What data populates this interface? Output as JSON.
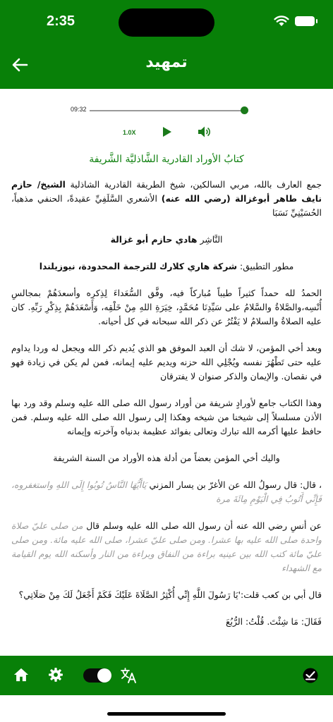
{
  "status": {
    "time": "2:35"
  },
  "header": {
    "title": "تمهيد"
  },
  "player": {
    "elapsed": "09:32",
    "speed": "1.0X",
    "progress": 0.98
  },
  "content": {
    "book_title": "كتابُ الأوراد القادرية الشَّاذليَّة الشَّريفة",
    "intro": "جمع العارف بالله، مربي السالكين، شيخ الطريقة القادرية الشاذلية ",
    "sheikh_name": "الشيخ/ حازم نايف طاهر أبوغزالة (رضي الله عنه)",
    "intro_rest": " الأشعري السَّلَفِيِّ عقيدةً، الحنفي مذهباً، الحُسَيْنِيِّ نَسَبَا",
    "publisher_label": "النَّاشِر ",
    "publisher_name": "هادي حازم أبو غزالة",
    "developer_label": "مطور التطبيق: ",
    "developer_name": "شركة هاري كلارك للترجمة المحدودة، نيوزيلندا",
    "para1": "الحمدُ لله حمداً كثيراً طيباً مُباركاً فيه، وفَّق السُّعَداءَ لِذِكرِه وأسعدَهُمْ بمجالسِ أُنْسِه،والصَّلاةُ والسَّلامُ على سَيِّدِنَا مُحَمَّدٍ، خِيَرَةِ اللهِ مِنْ خَلْقِه، وَأَسْعَدَهُمْ بِذِكْرِ رَبِّهِ. كان عليه الصلاةُ والسلامُ لا يَفْتُرُ عن ذكر الله سبحانه في كل أحيانه.",
    "para2": "وبعد أخي المؤمن، لا شك أن العبد الموفق هو الذي يُديم ذكر الله ويجعل له وردا يداوم عليه حتى تَطْهُرَ نفسه ويُجْلِي الله حزنه ويديم عليه إيمانه، فمن لم يكن في زيادة فهو في نقصان. والإيمان والذكر صنوان لا يفترقان",
    "para3": "وهذا الكتاب جامع لأورادٍ شريفة من أوراد رسول الله صلى الله عليه وسلم وقد ورد بها الأذن مسلسلاً إلى شيخنا من شيخه وهكذا إلى رسول الله صلى الله عليه وسلم. فمن حافظ عليها أكرمه الله تبارك وتعالى بفوائد عظيمة بدنياه وآخرته وإيمانه",
    "para4": "واليك أخي المؤمن بعضاً من أدلة هذه الأوراد من السنة الشريفة",
    "para5_a": "، قال: قال رسولُ الله عن الأغرّ بن يسار المزني ",
    "para5_b": "يَاأَيُّهَا النَّاسُ تُوبُوا إِلَى اللهِ واستغفروه، فَإِنِّي أَتُوبُ فِي الْيَوْمِ مِائَةَ مرة",
    "para6_a": "عن أنسِ رضي الله عنه أن رسول الله صلى الله عليه وسلم قال ",
    "para6_b": "من صلى عليّ صلاة واحدة صلى الله عليه بها عشرا. ومن صلى عليّ عشرا، صلى الله عليه مائة. ومن صلى عليّ مائة كتب الله بين عينيه براءة من النفاق وبراءة من النار وأسكنه الله يوم القيامة مع الشهداء",
    "para7": "قال أبي بن كعب قلت:'يَا رَسُولَ اللَّهِ إِنِّي أُكْثِرُ الصَّلَاةَ عَلَيْكَ فَكَمْ أَجْعَلُ لَكَ مِنْ صَلَاتِي؟",
    "para8": "فَقَالَ: مَا شِئْتَ. قُلْتُ: الرُّبُعَ"
  },
  "colors": {
    "primary": "#088008",
    "title_green": "#108010",
    "quote_gray": "#999999"
  },
  "icons": [
    "back-arrow-icon",
    "wifi-icon",
    "battery-icon",
    "play-icon",
    "volume-icon",
    "home-icon",
    "gear-icon",
    "translate-icon",
    "check-circle-icon"
  ]
}
